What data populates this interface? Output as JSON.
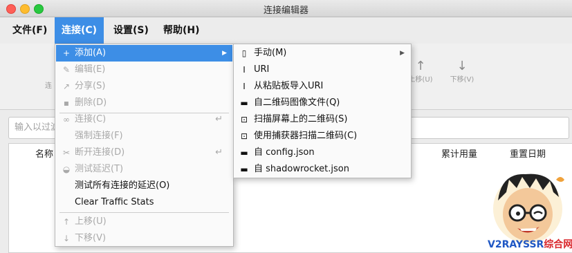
{
  "window": {
    "title": "连接编辑器"
  },
  "menubar": [
    {
      "label": "文件(F)",
      "active": false
    },
    {
      "label": "连接(C)",
      "active": true
    },
    {
      "label": "设置(S)",
      "active": false
    },
    {
      "label": "帮助(H)",
      "active": false
    }
  ],
  "toolbar": {
    "left_label": "连",
    "up_label": "上移(U)",
    "down_label": "下移(V)"
  },
  "filter": {
    "placeholder": "输入以过滤"
  },
  "table": {
    "columns": [
      "名称",
      "累计用量",
      "重置日期"
    ]
  },
  "connection_menu": {
    "add": "添加(A)",
    "edit": "编辑(E)",
    "share": "分享(S)",
    "delete": "删除(D)",
    "connect": "连接(C)",
    "force_connect": "强制连接(F)",
    "disconnect": "断开连接(D)",
    "test_latency": "测试延迟(T)",
    "test_all_latency": "测试所有连接的延迟(O)",
    "clear_traffic": "Clear Traffic Stats",
    "move_up": "上移(U)",
    "move_down": "下移(V)"
  },
  "add_submenu": {
    "manual": "手动(M)",
    "uri": "URI",
    "clipboard_uri": "从粘贴板导入URI",
    "qr_image_file": "自二维码图像文件(Q)",
    "scan_screen_qr": "扫描屏幕上的二维码(S)",
    "capture_qr": "使用捕获器扫描二维码(C)",
    "from_config": "自 config.json",
    "from_shadowrocket": "自 shadowrocket.json"
  },
  "watermark": {
    "text_blue": "V2RAYSSR",
    "text_red": "综合网"
  },
  "colors": {
    "highlight": "#3d8ee6",
    "disabled": "#a9a9a9"
  }
}
